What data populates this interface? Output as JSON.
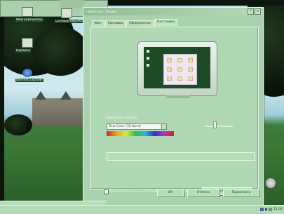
{
  "desktop": {
    "icons": [
      {
        "name": "my-computer-icon",
        "label": "Мой компьютер"
      },
      {
        "name": "network-icon",
        "label": "Сетевое окружение"
      },
      {
        "name": "recycle-bin-icon",
        "label": "Корзина"
      },
      {
        "name": "internet-explorer-icon",
        "label": "Internet Explorer"
      }
    ]
  },
  "dialog": {
    "title": "Свойства: Экран",
    "title_buttons": [
      "?",
      "×"
    ],
    "tabs": [
      {
        "label": "Фон"
      },
      {
        "label": "Заставка"
      },
      {
        "label": "Оформление"
      },
      {
        "label": "Настройка"
      }
    ],
    "active_tab": "Настройка",
    "color_palette": {
      "label": "Цветовая палитра",
      "value": "True Color (32 бита)"
    },
    "screen_area": {
      "label": "Область экрана"
    },
    "checkbox_label": "Показывать значок настройки на панели задач",
    "advanced_button": "Дополнительно...",
    "ok_button": "ОК",
    "cancel_button": "Отмена",
    "apply_button": "Применить"
  },
  "taskbar": {
    "clock": "12:00"
  },
  "colors": {
    "accent": "#a9d3ae",
    "tint": "#b0d8b4"
  }
}
